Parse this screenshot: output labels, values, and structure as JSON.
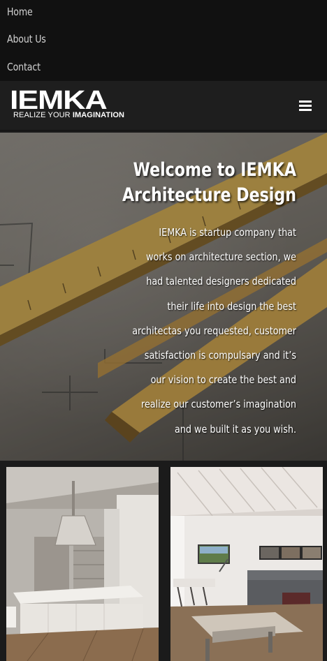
{
  "nav": {
    "items": [
      "Home",
      "About Us",
      "Contact"
    ]
  },
  "header": {
    "logo_text": "IEMKA",
    "tagline_prefix": "REALIZE YOUR ",
    "tagline_bold": "IMAGINATION",
    "menu_icon": "hamburger-menu-icon"
  },
  "hero": {
    "title_line1": "Welcome to IEMKA",
    "title_line2": "Architecture Design",
    "body": "IEMKA is startup company that works on architecture section, we had talented designers dedicated their life into design the best architectas you requested, customer satisfaction is compulsary and it’s our vision to create the best and realize our customer’s imagination and we built it as you wish."
  },
  "gallery": {
    "images": [
      "kitchen-interior-image",
      "living-room-interior-image"
    ]
  }
}
